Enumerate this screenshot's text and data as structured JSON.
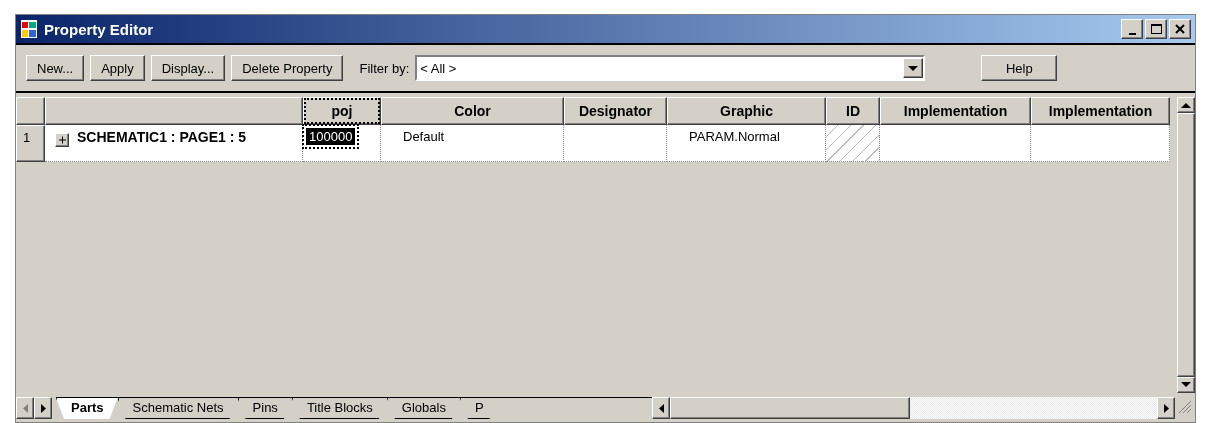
{
  "window": {
    "title": "Property Editor"
  },
  "toolbar": {
    "buttons": [
      "New...",
      "Apply",
      "Display...",
      "Delete Property"
    ],
    "filter_label": "Filter by:",
    "filter_value": "< All >",
    "help": "Help"
  },
  "grid": {
    "columns": [
      {
        "label": "poj",
        "selected": true
      },
      {
        "label": "Color",
        "selected": false
      },
      {
        "label": "Designator",
        "selected": false
      },
      {
        "label": "Graphic",
        "selected": false
      },
      {
        "label": "ID",
        "selected": false
      },
      {
        "label": "Implementation",
        "selected": false
      },
      {
        "label": "Implementation",
        "selected": false
      }
    ],
    "rows": [
      {
        "number": "1",
        "expanded": false,
        "name": "SCHEMATIC1 : PAGE1 : 5",
        "cells": [
          {
            "kind": "text",
            "value": "100000",
            "selected": true
          },
          {
            "kind": "text",
            "value": "Default",
            "selected": false
          },
          {
            "kind": "empty",
            "selected": false
          },
          {
            "kind": "text",
            "value": "PARAM.Normal",
            "selected": false
          },
          {
            "kind": "readonly",
            "selected": false
          },
          {
            "kind": "empty",
            "selected": false
          },
          {
            "kind": "empty",
            "selected": false
          }
        ]
      }
    ]
  },
  "tabs": [
    {
      "label": "Parts",
      "selected": true
    },
    {
      "label": "Schematic Nets",
      "selected": false
    },
    {
      "label": "Pins",
      "selected": false
    },
    {
      "label": "Title Blocks",
      "selected": false
    },
    {
      "label": "Globals",
      "selected": false
    },
    {
      "label": "P",
      "selected": false
    }
  ]
}
